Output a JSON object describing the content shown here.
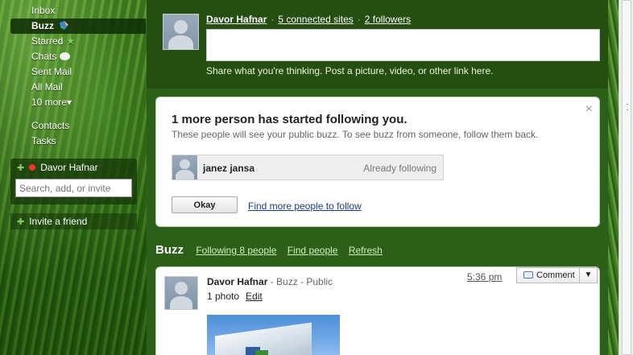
{
  "sidebar": {
    "nav": {
      "inbox": "Inbox",
      "buzz": "Buzz",
      "starred": "Starred",
      "chats": "Chats",
      "sent": "Sent Mail",
      "all": "All Mail",
      "more": "10 more▾",
      "contacts": "Contacts",
      "tasks": "Tasks"
    },
    "chat": {
      "user": "Davor Hafnar",
      "status_color": "#e33333",
      "search_placeholder": "Search, add, or invite"
    },
    "invite": "Invite a friend"
  },
  "share": {
    "name": "Davor Hafnar",
    "connected": "5 connected sites",
    "followers": "2 followers",
    "hint": "Share what you're thinking. Post a picture, video, or other link here."
  },
  "follow_card": {
    "title": "1 more person has started following you.",
    "subtitle": "These people will see your public buzz. To see buzz from someone, follow them back.",
    "follower_name": "janez jansa",
    "follower_status": "Already following",
    "okay": "Okay",
    "find_link": "Find more people to follow",
    "close": "×"
  },
  "buzz_bar": {
    "title": "Buzz",
    "following": "Following 8 people",
    "find": "Find people",
    "refresh": "Refresh"
  },
  "post": {
    "author": "Davor Hafnar",
    "meta": " - Buzz - Public",
    "photos": "1 photo",
    "edit": "Edit",
    "time": "5:36 pm",
    "comment": "Comment",
    "caret": "▼"
  },
  "icons": {
    "buzz": "buzz-icon",
    "star": "star-icon",
    "chat": "chat-bubble-icon",
    "close": "close-icon",
    "comment": "comment-icon"
  },
  "colors": {
    "link": "#1a3e7a",
    "theme_green": "#2c5f17"
  }
}
